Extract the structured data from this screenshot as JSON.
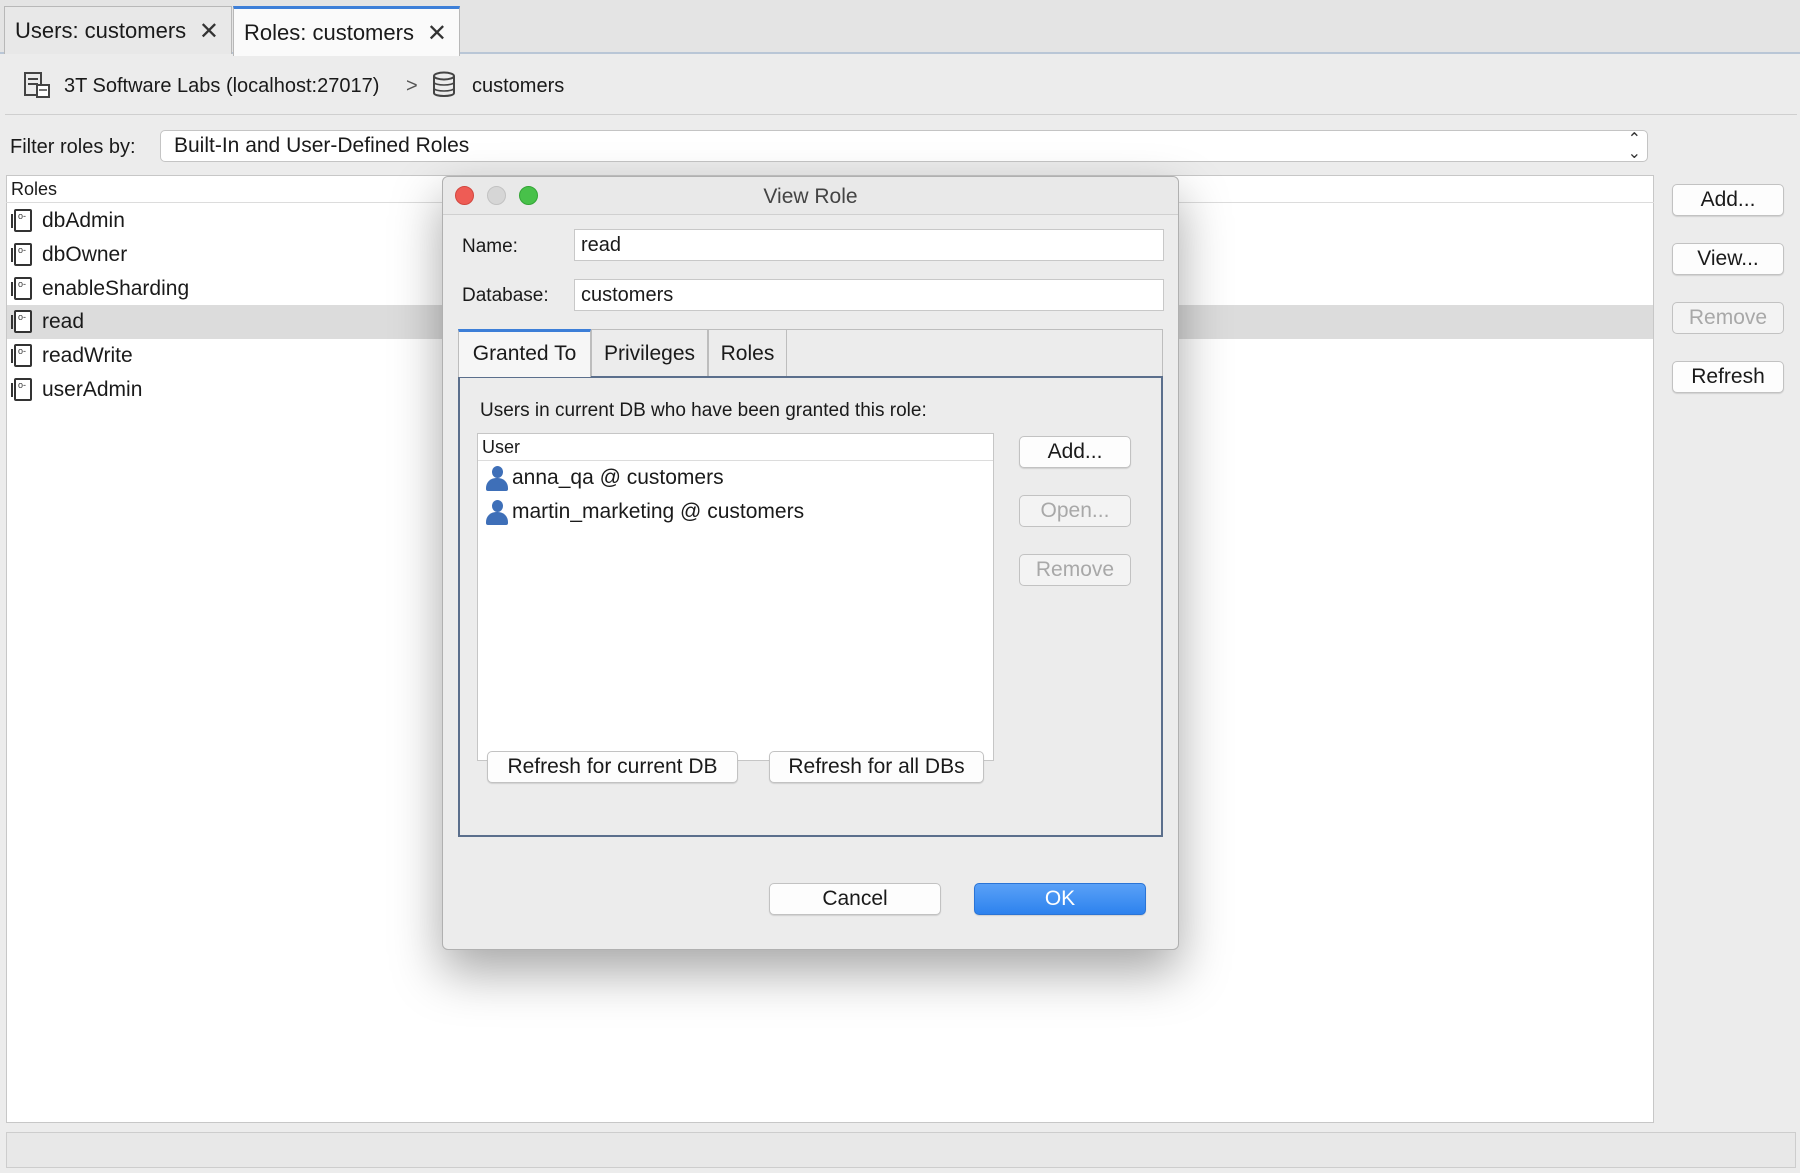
{
  "tabs": [
    {
      "label": "Users: customers",
      "close": "✕"
    },
    {
      "label": "Roles: customers",
      "close": "✕"
    }
  ],
  "breadcrumb": {
    "server": "3T Software Labs (localhost:27017)",
    "separator": ">",
    "database": "customers"
  },
  "filter": {
    "label": "Filter roles by:",
    "selected": "Built-In and User-Defined Roles"
  },
  "roles": {
    "header": "Roles",
    "items": [
      "dbAdmin",
      "dbOwner",
      "enableSharding",
      "read",
      "readWrite",
      "userAdmin"
    ],
    "selected": "read"
  },
  "side_buttons": {
    "add": "Add...",
    "view": "View...",
    "remove": "Remove",
    "refresh": "Refresh"
  },
  "dialog": {
    "title": "View Role",
    "name_label": "Name:",
    "name_value": "read",
    "database_label": "Database:",
    "database_value": "customers",
    "tabs": [
      "Granted To",
      "Privileges",
      "Roles"
    ],
    "active_tab": "Granted To",
    "granted_description": "Users in current DB who have been granted this role:",
    "user_header": "User",
    "users": [
      "anna_qa @ customers",
      "martin_marketing @ customers"
    ],
    "add_button": "Add...",
    "open_button": "Open...",
    "remove_button": "Remove",
    "refresh_current": "Refresh for current DB",
    "refresh_all": "Refresh for all DBs",
    "cancel": "Cancel",
    "ok": "OK"
  },
  "colors": {
    "accent": "#3d7fd8",
    "ok_button": "#2d82ee",
    "close_light": "#ee5c55",
    "minimize_light": "#d6d6d6",
    "zoom_light": "#48c14a",
    "user_icon": "#3e6fb8"
  }
}
